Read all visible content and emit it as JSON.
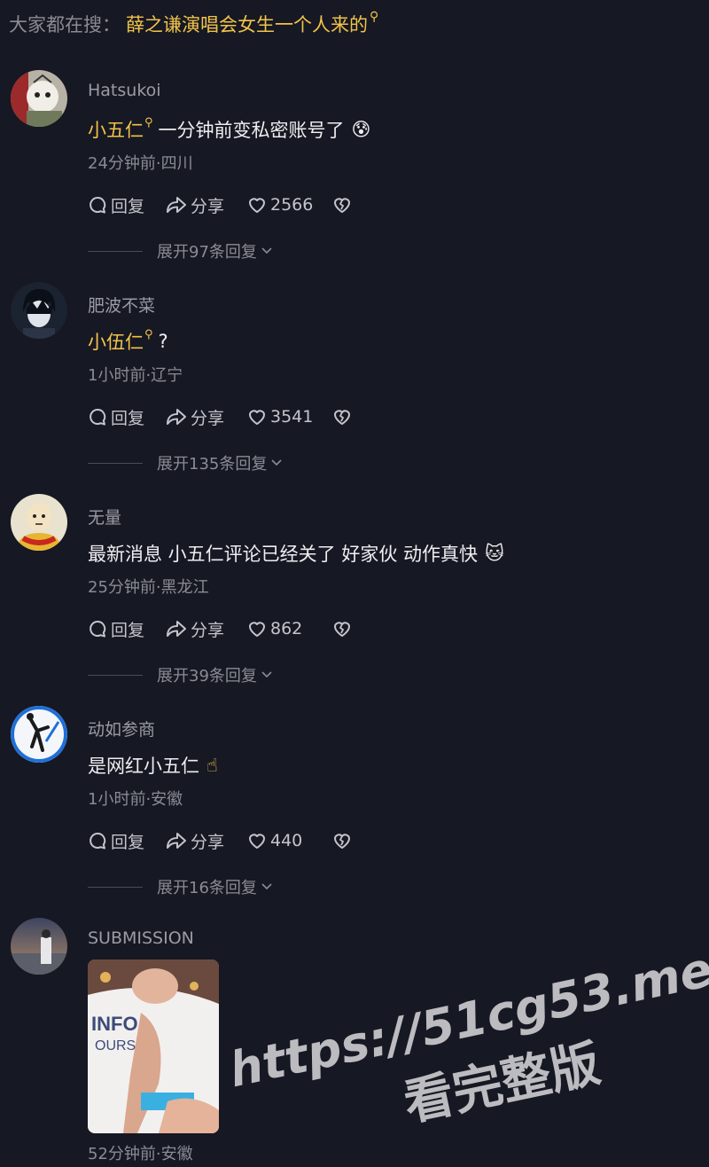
{
  "search_bar": {
    "prefix": "大家都在搜：",
    "query": "薛之谦演唱会女生一个人来的"
  },
  "actions": {
    "reply_label": "回复",
    "share_label": "分享"
  },
  "comments": [
    {
      "username": "Hatsukoi",
      "mention": "小五仁",
      "text": "一分钟前变私密账号了",
      "emoji": "😰",
      "meta": "24分钟前·四川",
      "likes": "2566",
      "expand": "展开97条回复"
    },
    {
      "username": "肥波不菜",
      "mention": "小伍仁",
      "text": "?",
      "emoji": "",
      "meta": "1小时前·辽宁",
      "likes": "3541",
      "expand": "展开135条回复"
    },
    {
      "username": "无量",
      "mention": "",
      "text": "最新消息 小五仁评论已经关了 好家伙 动作真快",
      "emoji": "🐱",
      "meta": "25分钟前·黑龙江",
      "likes": "862",
      "expand": "展开39条回复"
    },
    {
      "username": "动如参商",
      "mention": "",
      "text": "是网红小五仁",
      "emoji": "☝",
      "meta": "1小时前·安徽",
      "likes": "440",
      "expand": "展开16条回复"
    },
    {
      "username": "SUBMISSION",
      "meta": "52分钟前·安徽"
    }
  ],
  "watermark": {
    "line1": "https://51cg53.me",
    "line2": "看完整版"
  },
  "colors": {
    "background": "#161823",
    "highlight": "#f2c34a",
    "secondary_text": "#8a8b93"
  }
}
